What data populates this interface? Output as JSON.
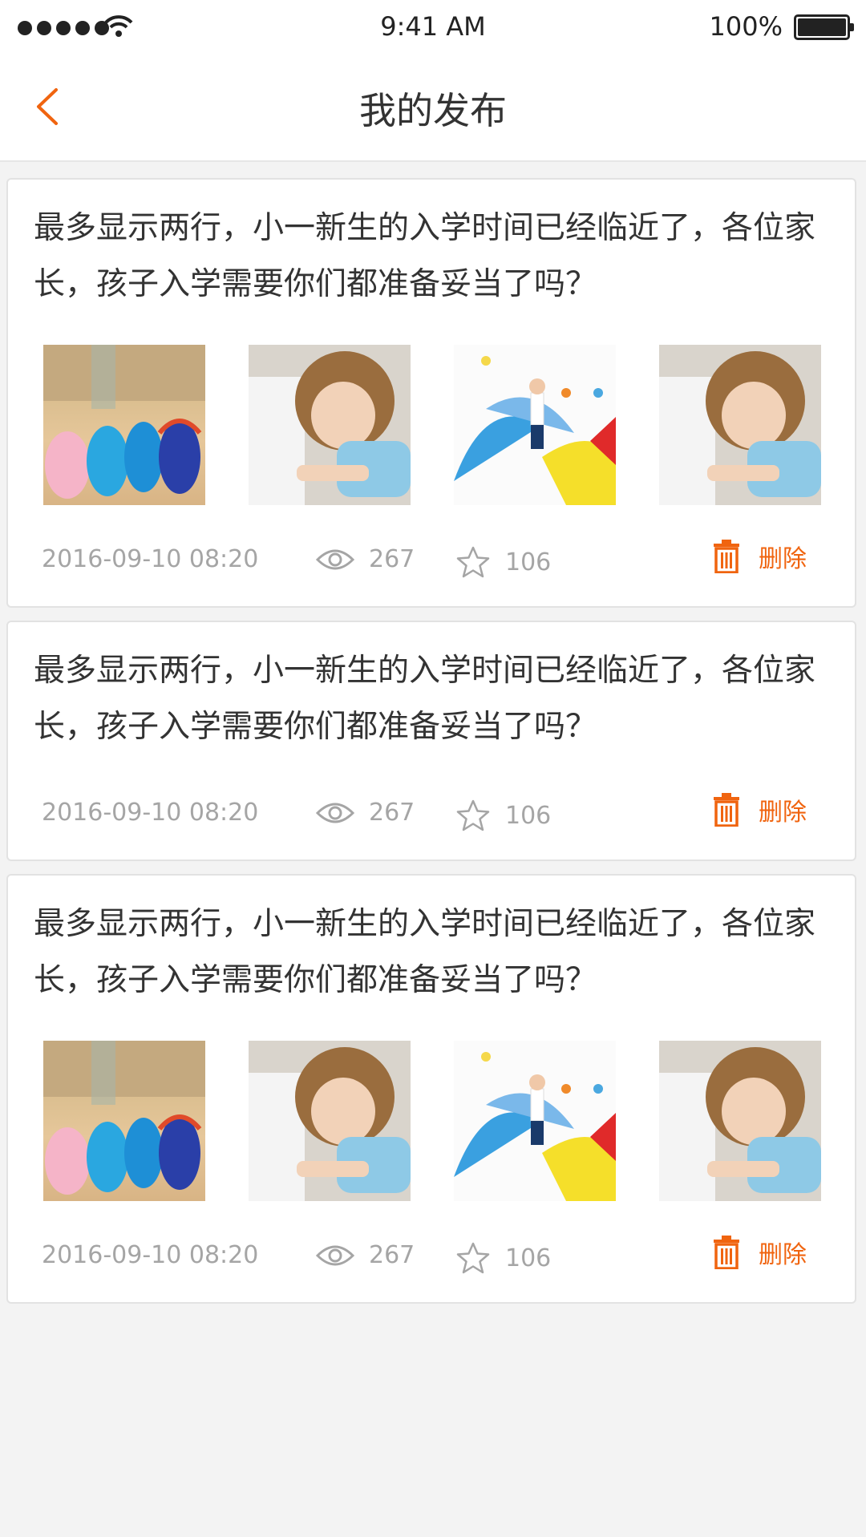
{
  "status_bar": {
    "time": "9:41 AM",
    "battery": "100%"
  },
  "nav": {
    "title": "我的发布"
  },
  "colors": {
    "accent": "#f0640f"
  },
  "posts": [
    {
      "text": "最多显示两行，小一新生的入学时间已经临近了，各位家长，孩子入学需要你们都准备妥当了吗？",
      "images": [
        "shoes",
        "girl-laptop",
        "child-umbrellas",
        "girl-laptop"
      ],
      "date": "2016-09-10  08:20",
      "views": "267",
      "favorites": "106",
      "delete_label": "删除"
    },
    {
      "text": "最多显示两行，小一新生的入学时间已经临近了，各位家长，孩子入学需要你们都准备妥当了吗？",
      "images": [],
      "date": "2016-09-10  08:20",
      "views": "267",
      "favorites": "106",
      "delete_label": "删除"
    },
    {
      "text": "最多显示两行，小一新生的入学时间已经临近了，各位家长，孩子入学需要你们都准备妥当了吗？",
      "images": [
        "shoes",
        "girl-laptop",
        "child-umbrellas",
        "girl-laptop"
      ],
      "date": "2016-09-10  08:20",
      "views": "267",
      "favorites": "106",
      "delete_label": "删除"
    }
  ]
}
